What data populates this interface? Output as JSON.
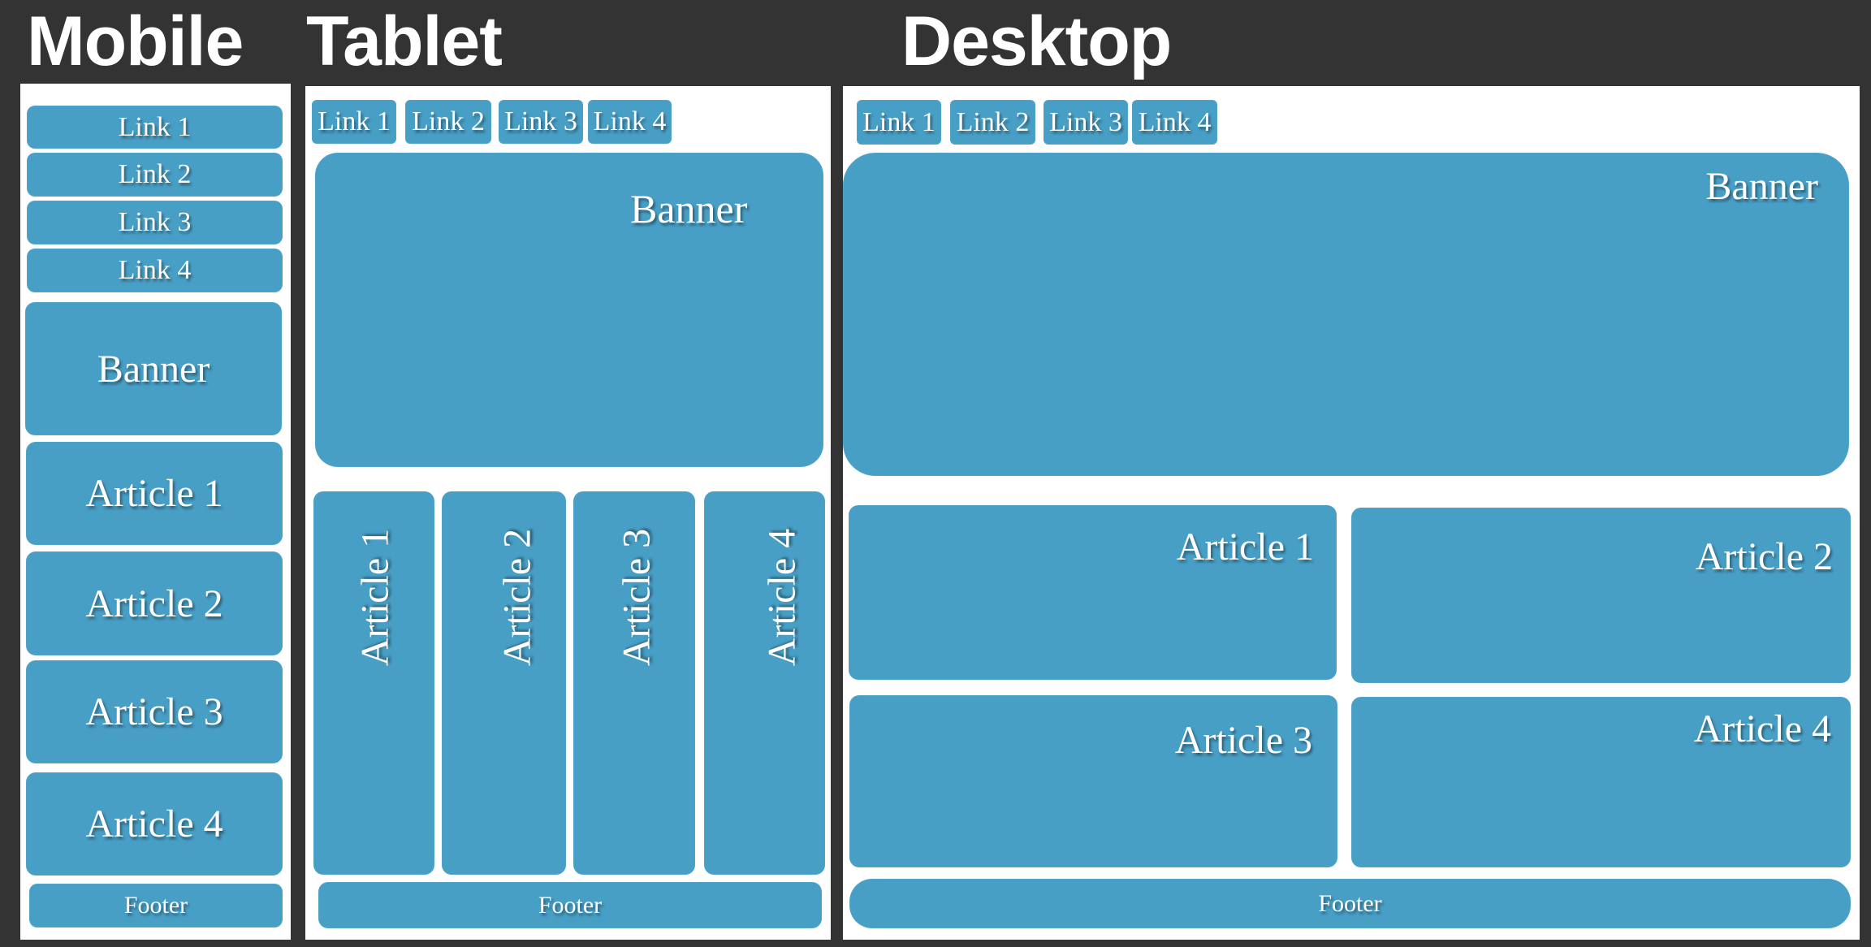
{
  "colors": {
    "background": "#333333",
    "panel": "#ffffff",
    "block": "#489fc6",
    "text": "#ffffff"
  },
  "mobile": {
    "title": "Mobile",
    "links": [
      "Link 1",
      "Link 2",
      "Link 3",
      "Link 4"
    ],
    "banner": "Banner",
    "articles": [
      "Article 1",
      "Article 2",
      "Article 3",
      "Article 4"
    ],
    "footer": "Footer"
  },
  "tablet": {
    "title": "Tablet",
    "links": [
      "Link 1",
      "Link 2",
      "Link 3",
      "Link 4"
    ],
    "banner": "Banner",
    "articles": [
      "Article 1",
      "Article 2",
      "Article 3",
      "Article 4"
    ],
    "footer": "Footer"
  },
  "desktop": {
    "title": "Desktop",
    "links": [
      "Link 1",
      "Link 2",
      "Link 3",
      "Link 4"
    ],
    "banner": "Banner",
    "articles": [
      "Article 1",
      "Article 2",
      "Article 3",
      "Article 4"
    ],
    "footer": "Footer"
  }
}
